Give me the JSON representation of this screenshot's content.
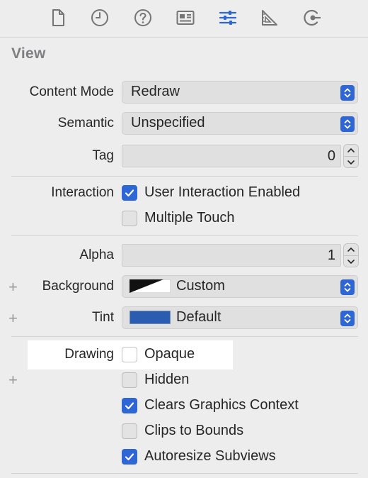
{
  "colors": {
    "accent": "#2f66d6",
    "tint_swatch": "#2a5cb0",
    "background_swatch": "#111111"
  },
  "toolbar": {
    "icons": [
      "file-icon",
      "clock-icon",
      "help-icon",
      "identity-card-icon",
      "attributes-sliders-icon",
      "size-ruler-icon",
      "connections-arrow-icon"
    ],
    "selected": "attributes-sliders-icon"
  },
  "section": {
    "title": "View"
  },
  "content_mode": {
    "label": "Content Mode",
    "value": "Redraw"
  },
  "semantic": {
    "label": "Semantic",
    "value": "Unspecified"
  },
  "tag": {
    "label": "Tag",
    "value": "0"
  },
  "interaction": {
    "label": "Interaction",
    "options": [
      {
        "label": "User Interaction Enabled",
        "checked": true
      },
      {
        "label": "Multiple Touch",
        "checked": false
      }
    ]
  },
  "alpha": {
    "label": "Alpha",
    "value": "1"
  },
  "background": {
    "label": "Background",
    "value": "Custom",
    "plus": "+"
  },
  "tint": {
    "label": "Tint",
    "value": "Default",
    "plus": "+"
  },
  "drawing": {
    "label": "Drawing",
    "plus": "+",
    "options": [
      {
        "label": "Opaque",
        "checked": false
      },
      {
        "label": "Hidden",
        "checked": false
      },
      {
        "label": "Clears Graphics Context",
        "checked": true
      },
      {
        "label": "Clips to Bounds",
        "checked": false
      },
      {
        "label": "Autoresize Subviews",
        "checked": true
      }
    ]
  }
}
